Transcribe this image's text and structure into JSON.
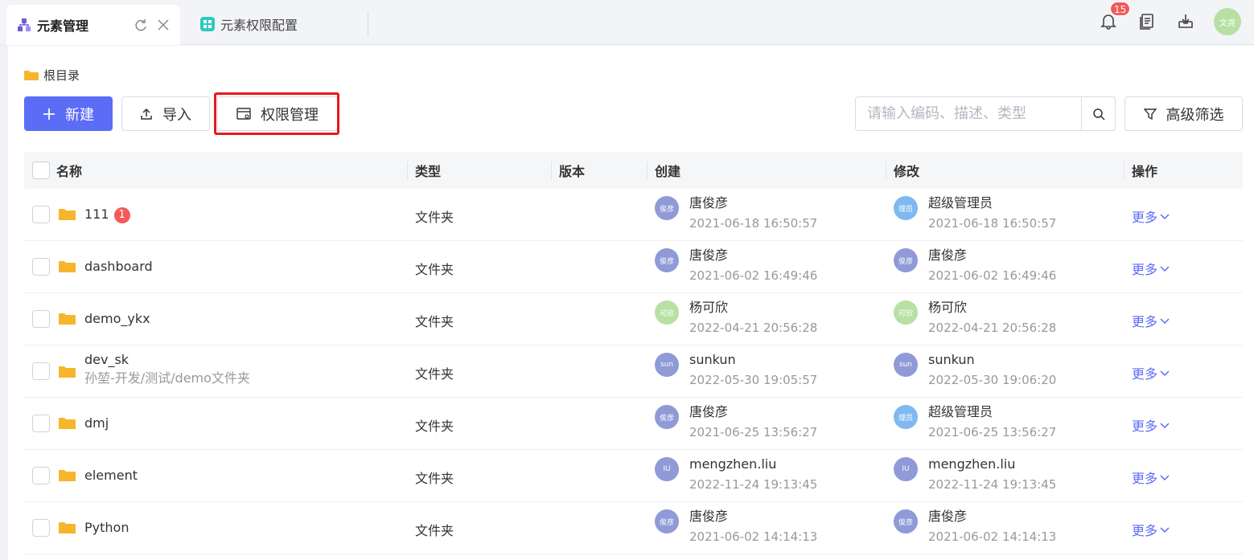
{
  "tabs": [
    {
      "label": "元素管理",
      "active": true
    },
    {
      "label": "元素权限配置",
      "active": false
    }
  ],
  "header": {
    "notification_count": "15",
    "user_avatar_text": "文尧"
  },
  "breadcrumb": {
    "label": "根目录"
  },
  "toolbar": {
    "new_label": "新建",
    "import_label": "导入",
    "permission_label": "权限管理",
    "search_placeholder": "请输入编码、描述、类型",
    "filter_label": "高级筛选"
  },
  "columns": {
    "name": "名称",
    "type": "类型",
    "version": "版本",
    "created": "创建",
    "modified": "修改",
    "actions": "操作"
  },
  "rows": [
    {
      "name": "111",
      "badge": "1",
      "subtitle": "",
      "type": "文件夹",
      "creator": {
        "avatar": "俊彦",
        "color": "#8f9ad6",
        "name": "唐俊彦",
        "time": "2021-06-18 16:50:57"
      },
      "modifier": {
        "avatar": "理员",
        "color": "#7fb9f0",
        "name": "超级管理员",
        "time": "2021-06-18 16:50:57"
      },
      "action": "更多"
    },
    {
      "name": "dashboard",
      "badge": "",
      "subtitle": "",
      "type": "文件夹",
      "creator": {
        "avatar": "俊彦",
        "color": "#8f9ad6",
        "name": "唐俊彦",
        "time": "2021-06-02 16:49:46"
      },
      "modifier": {
        "avatar": "俊彦",
        "color": "#8f9ad6",
        "name": "唐俊彦",
        "time": "2021-06-02 16:49:46"
      },
      "action": "更多"
    },
    {
      "name": "demo_ykx",
      "badge": "",
      "subtitle": "",
      "type": "文件夹",
      "creator": {
        "avatar": "可欣",
        "color": "#b8e0a4",
        "name": "杨可欣",
        "time": "2022-04-21 20:56:28"
      },
      "modifier": {
        "avatar": "可欣",
        "color": "#b8e0a4",
        "name": "杨可欣",
        "time": "2022-04-21 20:56:28"
      },
      "action": "更多"
    },
    {
      "name": "dev_sk",
      "badge": "",
      "subtitle": "孙堃-开发/测试/demo文件夹",
      "type": "文件夹",
      "creator": {
        "avatar": "sun",
        "color": "#8f9ad6",
        "name": "sunkun",
        "time": "2022-05-30 19:05:57"
      },
      "modifier": {
        "avatar": "sun",
        "color": "#8f9ad6",
        "name": "sunkun",
        "time": "2022-05-30 19:06:20"
      },
      "action": "更多"
    },
    {
      "name": "dmj",
      "badge": "",
      "subtitle": "",
      "type": "文件夹",
      "creator": {
        "avatar": "俊彦",
        "color": "#8f9ad6",
        "name": "唐俊彦",
        "time": "2021-06-25 13:56:27"
      },
      "modifier": {
        "avatar": "理员",
        "color": "#7fb9f0",
        "name": "超级管理员",
        "time": "2021-06-25 13:56:27"
      },
      "action": "更多"
    },
    {
      "name": "element",
      "badge": "",
      "subtitle": "",
      "type": "文件夹",
      "creator": {
        "avatar": "IU",
        "color": "#8f9ad6",
        "name": "mengzhen.liu",
        "time": "2022-11-24 19:13:45"
      },
      "modifier": {
        "avatar": "IU",
        "color": "#8f9ad6",
        "name": "mengzhen.liu",
        "time": "2022-11-24 19:13:45"
      },
      "action": "更多"
    },
    {
      "name": "Python",
      "badge": "",
      "subtitle": "",
      "type": "文件夹",
      "creator": {
        "avatar": "俊彦",
        "color": "#8f9ad6",
        "name": "唐俊彦",
        "time": "2021-06-02 14:14:13"
      },
      "modifier": {
        "avatar": "俊彦",
        "color": "#8f9ad6",
        "name": "唐俊彦",
        "time": "2021-06-02 14:14:13"
      },
      "action": "更多"
    }
  ]
}
